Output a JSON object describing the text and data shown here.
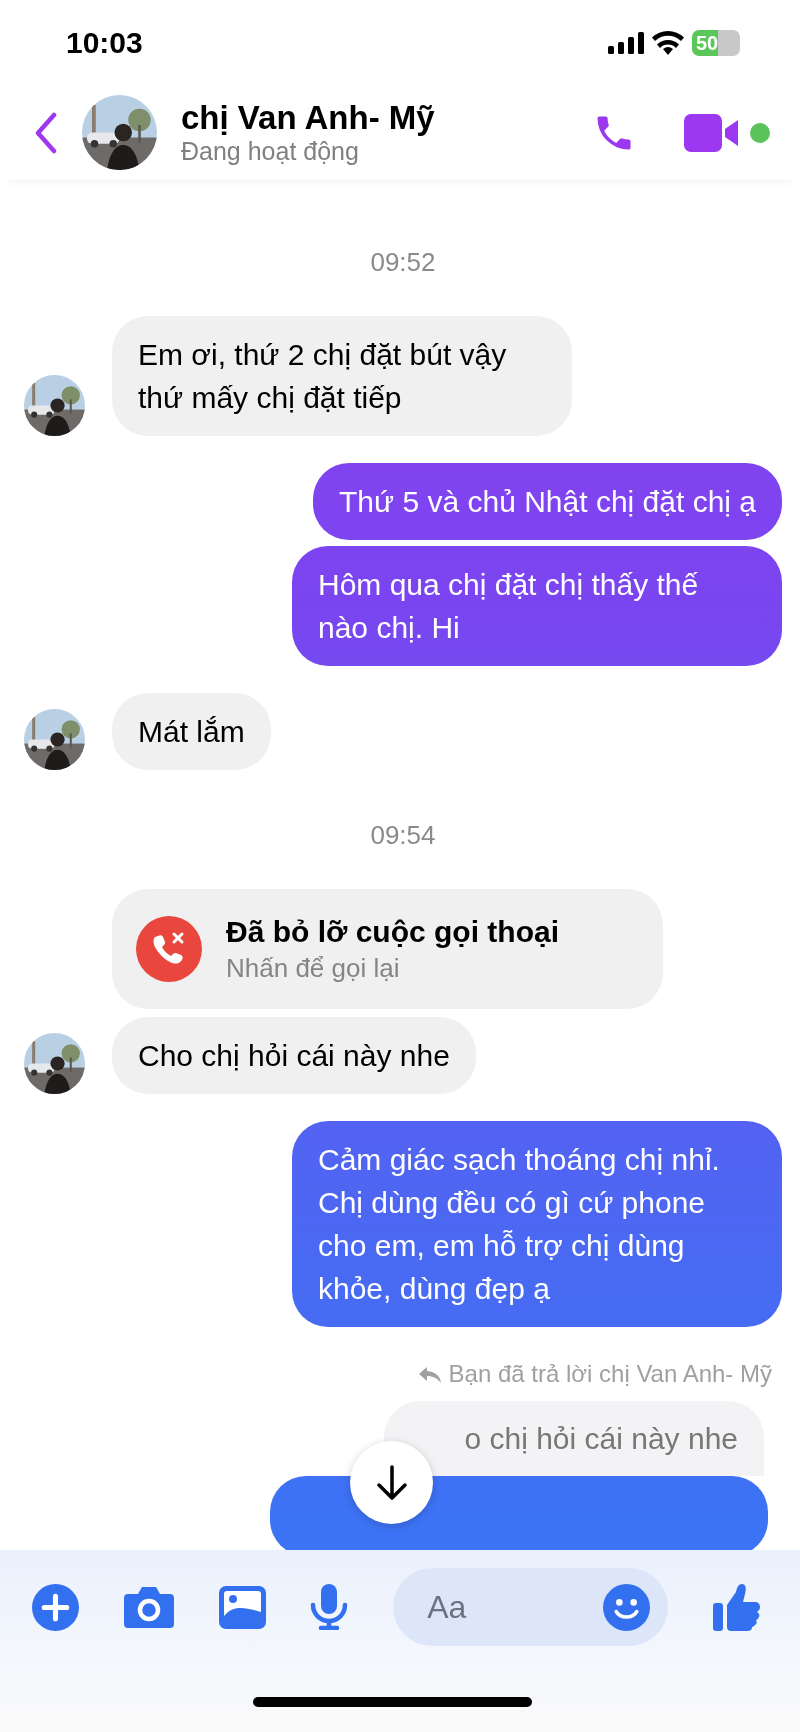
{
  "status_bar": {
    "time": "10:03",
    "battery": "50"
  },
  "header": {
    "name": "chị Van Anh- Mỹ",
    "status": "Đang hoạt động",
    "online": true
  },
  "messages": [
    {
      "kind": "time",
      "text": "09:52"
    },
    {
      "kind": "received",
      "text": "Em ơi, thứ 2 chị đặt bút vậy thứ mấy chị đặt tiếp",
      "avatar": true
    },
    {
      "kind": "sent",
      "text": "Thứ 5 và chủ Nhật chị đặt chị ạ"
    },
    {
      "kind": "sent",
      "text": "Hôm qua chị đặt chị thấy thế nào chị. Hi"
    },
    {
      "kind": "received",
      "text": "Mát lắm",
      "avatar": true
    },
    {
      "kind": "time",
      "text": "09:54"
    },
    {
      "kind": "call",
      "title": "Đã bỏ lỡ cuộc gọi thoại",
      "subtitle": "Nhấn để gọi lại",
      "avatar": false
    },
    {
      "kind": "received",
      "text": "Cho chị hỏi cái này nhe",
      "avatar": true
    },
    {
      "kind": "sent",
      "text": "Cảm giác sạch thoáng chị nhỉ. Chị dùng đều có gì cứ phone cho em, em hỗ trợ chị dùng khỏe, dùng đẹp ạ"
    },
    {
      "kind": "reply_note",
      "text": "Bạn đã trả lời chị Van Anh- Mỹ"
    },
    {
      "kind": "quoted",
      "text": "o chị hỏi cái này nhe"
    },
    {
      "kind": "hidden_sent"
    }
  ],
  "composer": {
    "placeholder": "Aa"
  }
}
